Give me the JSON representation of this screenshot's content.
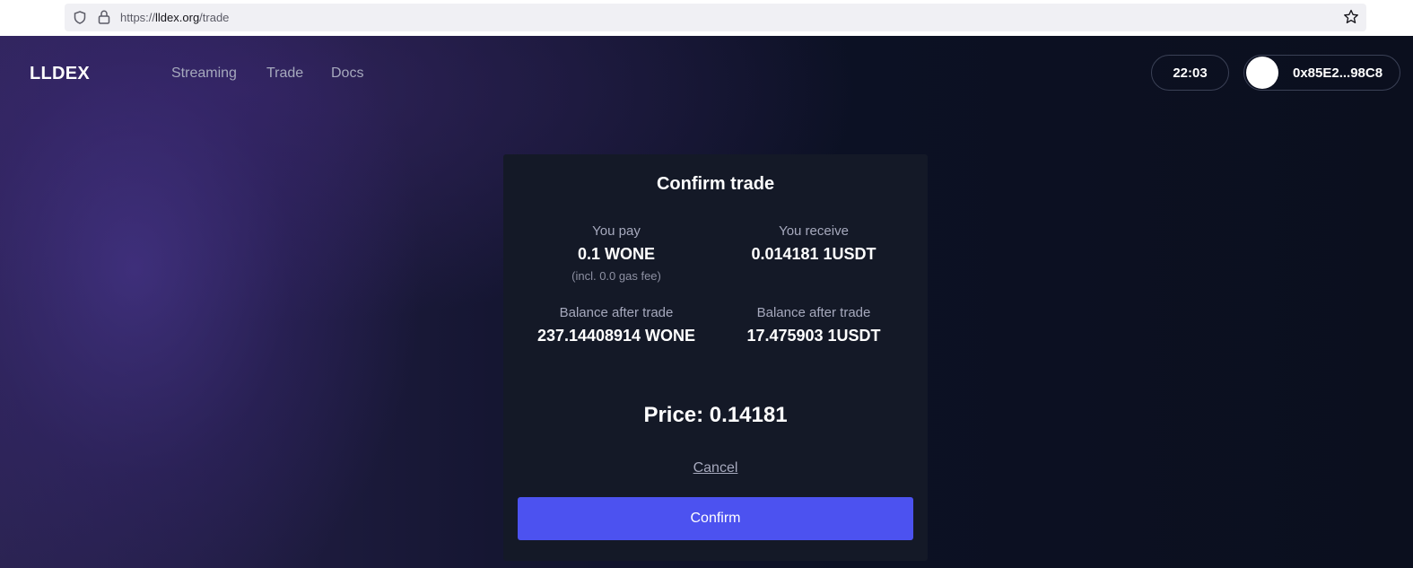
{
  "browser": {
    "url_prefix": "https://",
    "url_host": "lldex.org",
    "url_path": "/trade"
  },
  "header": {
    "logo": "LLDEX",
    "nav": [
      {
        "label": "Streaming"
      },
      {
        "label": "Trade"
      },
      {
        "label": "Docs"
      }
    ],
    "time": "22:03",
    "wallet_address": "0x85E2...98C8"
  },
  "modal": {
    "title": "Confirm trade",
    "pay_label": "You pay",
    "pay_value": "0.1 WONE",
    "pay_note": "(incl. 0.0 gas fee)",
    "receive_label": "You receive",
    "receive_value": "0.014181 1USDT",
    "balance_left_label": "Balance after trade",
    "balance_left_value": "237.14408914 WONE",
    "balance_right_label": "Balance after trade",
    "balance_right_value": "17.475903 1USDT",
    "price": "Price: 0.14181",
    "cancel_label": "Cancel",
    "confirm_label": "Confirm"
  },
  "colors": {
    "accent": "#4c52f0",
    "modal_bg": "#141927",
    "page_bg": "#0c1124"
  }
}
